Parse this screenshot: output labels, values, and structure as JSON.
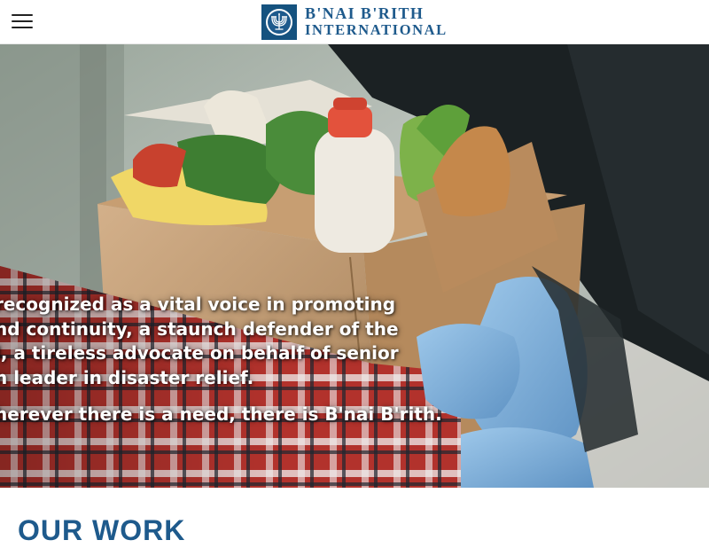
{
  "header": {
    "menu_icon": "hamburger-menu-icon",
    "logo": {
      "emblem_icon": "menorah-icon",
      "line1": "B'NAI B'RITH",
      "line2": "INTERNATIONAL"
    }
  },
  "hero": {
    "image": "volunteer-handing-grocery-box-photo",
    "text_lines": [
      "recognized as a vital voice in promoting",
      "nd continuity, a staunch defender of the",
      "l, a tireless advocate on behalf of senior",
      "n leader in disaster relief."
    ],
    "tagline": "herever there is a need, there is B'nai B'rith."
  },
  "section": {
    "title": "OUR WORK"
  },
  "colors": {
    "brand_blue": "#1e5a8c",
    "header_bg": "#ffffff"
  }
}
